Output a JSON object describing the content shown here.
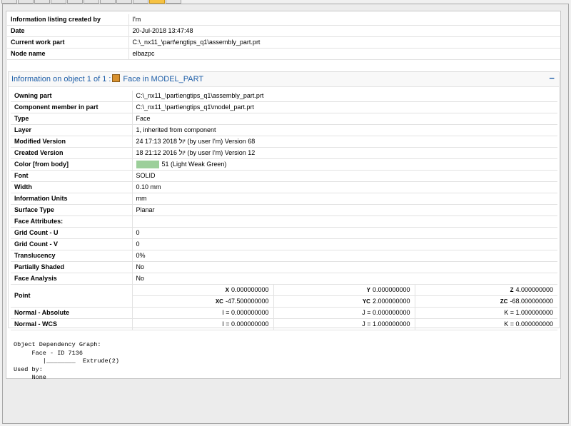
{
  "header_rows": [
    {
      "key": "Information listing created by",
      "value": "I'm"
    },
    {
      "key": "Date",
      "value": "20-Jul-2018 13:47:48"
    },
    {
      "key": "Current work part",
      "value": "C:\\_nx11_\\part\\engtips_q1\\assembly_part.prt"
    },
    {
      "key": "Node name",
      "value": "elbazpc"
    }
  ],
  "object_title": "Information on object 1 of 1 :",
  "object_name": "Face in MODEL_PART",
  "collapse_symbol": "−",
  "object_rows": [
    {
      "key": "Owning part",
      "value": "C:\\_nx11_\\part\\engtips_q1\\assembly_part.prt"
    },
    {
      "key": "Component member in part",
      "value": "C:\\_nx11_\\part\\engtips_q1\\model_part.prt"
    },
    {
      "key": "Type",
      "value": "Face"
    },
    {
      "key": "Layer",
      "value": "1, inherited from component"
    },
    {
      "key": "Modified Version",
      "value": "24 17:13 2018 יול (by user I'm) Version 68"
    },
    {
      "key": "Created Version",
      "value": "18 21:12 2016 יול (by user I'm) Version 12"
    },
    {
      "key": "Color [from body]",
      "value": "51 (Light Weak Green)",
      "swatch": "#9ccf9a"
    },
    {
      "key": "Font",
      "value": "SOLID"
    },
    {
      "key": "Width",
      "value": "0.10 mm"
    },
    {
      "key": "Information Units",
      "value": "mm"
    },
    {
      "key": "Surface Type",
      "value": "Planar"
    },
    {
      "key": "Face Attributes:",
      "value": ""
    },
    {
      "key": "Grid Count - U",
      "value": "0"
    },
    {
      "key": "Grid Count - V",
      "value": "0"
    },
    {
      "key": "Translucency",
      "value": "0%"
    },
    {
      "key": "Partially Shaded",
      "value": "No"
    },
    {
      "key": "Face Analysis",
      "value": "No"
    }
  ],
  "point": {
    "label": "Point",
    "abs": [
      {
        "axis": "X",
        "value": "0.000000000"
      },
      {
        "axis": "Y",
        "value": "0.000000000"
      },
      {
        "axis": "Z",
        "value": "4.000000000"
      }
    ],
    "wcs": [
      {
        "axis": "XC",
        "value": "-47.500000000"
      },
      {
        "axis": "YC",
        "value": "2.000000000"
      },
      {
        "axis": "ZC",
        "value": "-68.000000000"
      }
    ]
  },
  "normals": [
    {
      "label": "Normal - Absolute",
      "i": "I = 0.000000000",
      "j": "J = 0.000000000",
      "k": "K = 1.000000000"
    },
    {
      "label": "Normal - WCS",
      "i": "I = 0.000000000",
      "j": "J = 1.000000000",
      "k": "K = 0.000000000"
    }
  ],
  "dependency_text": "Object Dependency Graph:\n     Face - ID 7136\n        |________  Extrude(2)\nUsed by:\n     None",
  "colors": {
    "accent": "#1f5fa8",
    "active_tab": "#f6c243"
  }
}
